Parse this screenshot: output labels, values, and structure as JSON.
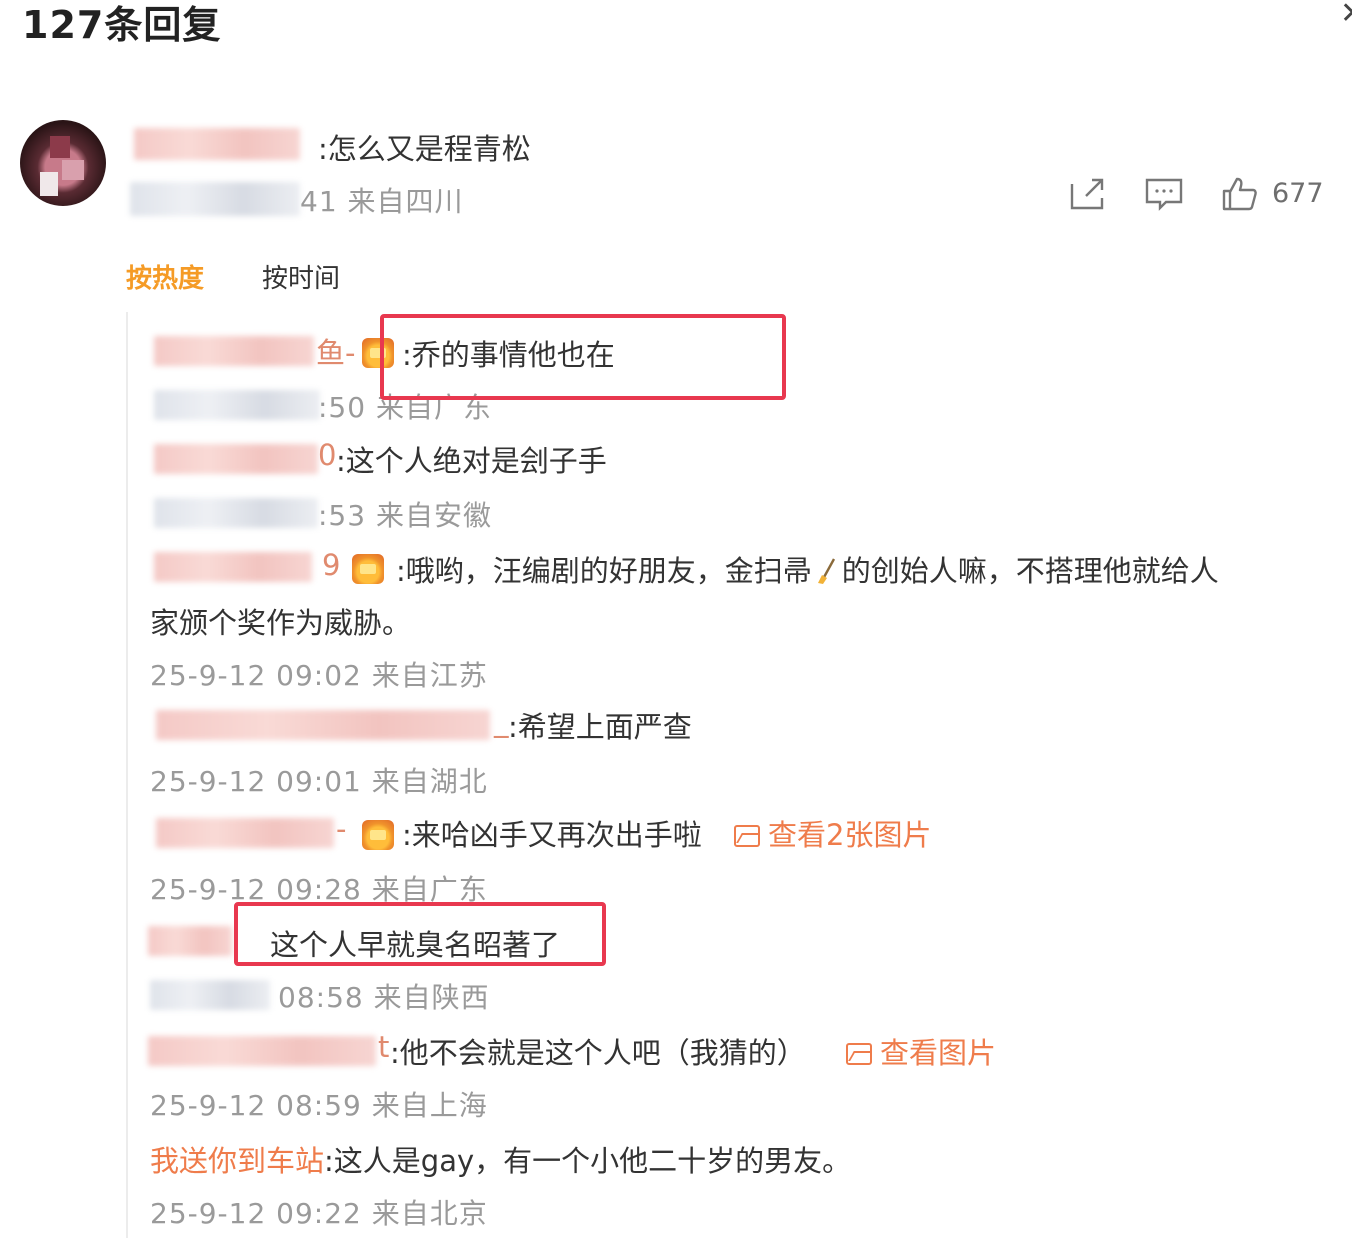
{
  "header": {
    "reply_count": "127条回复"
  },
  "main_comment": {
    "text": ":怎么又是程青松",
    "meta": "41 来自四川",
    "like_count": "677"
  },
  "sort_tabs": {
    "hot": "按热度",
    "time": "按时间"
  },
  "replies": [
    {
      "text": ":乔的事情他也在",
      "meta": ":50 来自广东",
      "name_tail": "鱼-"
    },
    {
      "text": ":这个人绝对是刽子手",
      "meta": ":53 来自安徽",
      "name_tail": "0"
    },
    {
      "text": ":哦哟，汪编剧的好朋友，金扫帚",
      "text_cont": "的创始人嘛，不搭理他就给人",
      "text_line2": "家颁个奖作为威胁。",
      "meta": "25-9-12 09:02 来自江苏",
      "name_tail": "9"
    },
    {
      "text": ":希望上面严查",
      "meta": "25-9-12 09:01 来自湖北",
      "name_tail": "_"
    },
    {
      "text": ":来哈凶手又再次出手啦",
      "link": "查看2张图片",
      "meta": "25-9-12 09:28 来自广东",
      "name_tail": "-"
    },
    {
      "text": "这个人早就臭名昭著了",
      "meta": "08:58 来自陕西"
    },
    {
      "text": ":他不会就是这个人吧（我猜的）",
      "link": "查看图片",
      "meta": "25-9-12 08:59 来自上海",
      "name_tail": "t"
    },
    {
      "user": "我送你到车站",
      "text": ":这人是gay，有一个小他二十岁的男友。",
      "meta": "25-9-12 09:22 来自北京"
    }
  ],
  "colors": {
    "accent_orange": "#f59b26",
    "link_orange": "#ef7c4b",
    "highlight_red": "#e8384f",
    "meta_gray": "#9a9a9a"
  },
  "icons": [
    "close-icon",
    "share-icon",
    "comment-icon",
    "like-icon",
    "image-icon",
    "crown-icon",
    "broom-icon"
  ]
}
